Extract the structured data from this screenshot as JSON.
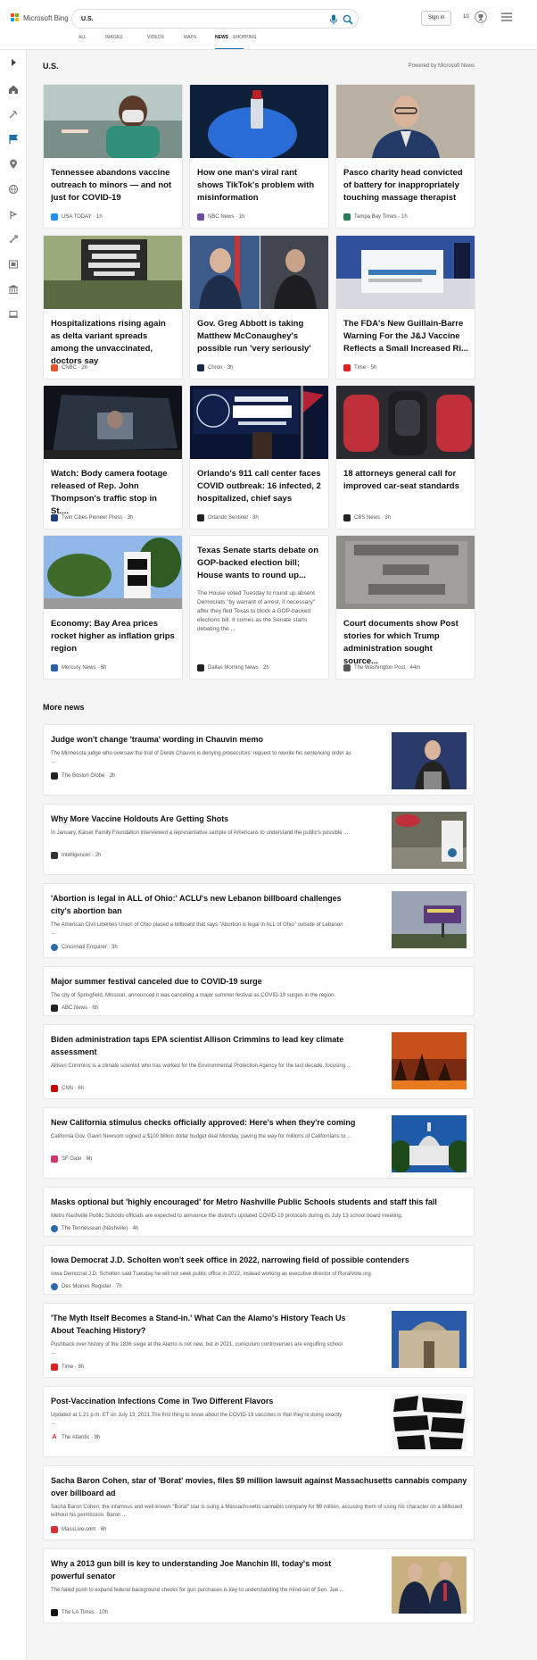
{
  "header": {
    "brand": "Microsoft Bing",
    "search_value": "U.S.",
    "signin_label": "Sign in",
    "rewards_count": "10",
    "tabs": [
      "ALL",
      "IMAGES",
      "VIDEOS",
      "MAPS",
      "NEWS",
      "SHOPPING"
    ],
    "active_tab": "NEWS"
  },
  "section": {
    "title": "U.S.",
    "powered_by": "Powered by Microsoft News"
  },
  "cards": [
    {
      "title": "Tennessee abandons vaccine outreach to minors — and not just for COVID-19",
      "source": "USA TODAY",
      "age": "1h",
      "favicon_color": "#1e90ff"
    },
    {
      "title": "How one man's viral rant shows TikTok's problem with misinformation",
      "source": "NBC News",
      "age": "1h",
      "favicon_color": "#6b4aa0"
    },
    {
      "title": "Pasco charity head convicted of battery for inappropriately touching massage therapist",
      "source": "Tampa Bay Times",
      "age": "1h",
      "favicon_color": "#2a7a5a"
    },
    {
      "title": "Hospitalizations rising again as delta variant spreads among the unvaccinated, doctors say",
      "source": "CNBC",
      "age": "2h",
      "favicon_color": "#e4572e"
    },
    {
      "title": "Gov. Greg Abbott is taking Matthew McConaughey's possible run 'very seriously'",
      "source": "Chron",
      "age": "3h",
      "favicon_color": "#1a2a44"
    },
    {
      "title": "The FDA's New Guillain-Barre Warning For the J&J Vaccine Reflects a Small Increased Ri...",
      "source": "Time",
      "age": "5h",
      "favicon_color": "#e32020"
    },
    {
      "title": "Watch: Body camera footage released of Rep. John Thompson's traffic stop in St....",
      "source": "Twin Cities Pioneer Press",
      "age": "3h",
      "favicon_color": "#1f3d7a"
    },
    {
      "title": "Orlando's 911 call center faces COVID outbreak: 16 infected, 2 hospitalized, chief says",
      "source": "Orlando Sentinel",
      "age": "3h",
      "favicon_color": "#222222"
    },
    {
      "title": "18 attorneys general call for improved car-seat standards",
      "source": "CBS News",
      "age": "3h",
      "favicon_color": "#222222"
    },
    {
      "title": "Economy: Bay Area prices rocket higher as inflation grips region",
      "source": "Mercury News",
      "age": "6h",
      "favicon_color": "#2b5ea8"
    },
    {
      "title": "Texas Senate starts debate on GOP-backed election bill; House wants to round up...",
      "source": "Dallas Morning News",
      "age": "2h",
      "favicon_color": "#222222",
      "description": "The House voted Tuesday to round up absent Democrats \"by warrant of arrest, if necessary\" after they fled Texas to block a GOP-backed elections bill. It comes as the Senate starts debating the ..."
    },
    {
      "title": "Court documents show Post stories for which Trump administration sought source...",
      "source": "The Washington Post",
      "age": "44m",
      "favicon_color": "#555555"
    }
  ],
  "more_news": {
    "title": "More news",
    "items": [
      {
        "title": "Judge won't change 'trauma' wording in Chauvin memo",
        "description": "The Minnesota judge who oversaw the trial of Derek Chauvin is denying prosecutors' request to rewrite his sentencing order as ...",
        "source": "The Boston Globe",
        "age": "2h",
        "favicon_color": "#222222"
      },
      {
        "title": "Why More Vaccine Holdouts Are Getting Shots",
        "description": "In January, Kaiser Family Foundation interviewed a representative sample of Americans to understand the public's possible ...",
        "source": "Intelligencer",
        "age": "2h",
        "favicon_color": "#333333"
      },
      {
        "title": "'Abortion is legal in ALL of Ohio:' ACLU's new Lebanon billboard challenges city's abortion ban",
        "description": "The American Civil Liberties Union of Ohio placed a billboard that says \"Abortion is legal in ALL of Ohio\" outside of Lebanon ...",
        "source": "Cincinnati Enquirer",
        "age": "3h",
        "favicon_color": "#2b6cb0"
      },
      {
        "title": "Major summer festival canceled due to COVID-19 surge",
        "description": "The city of Springfield, Missouri, announced it was canceling a major summer festival as COVID-19 surges in the region.",
        "source": "ABC News",
        "age": "6h",
        "favicon_color": "#222222"
      },
      {
        "title": "Biden administration taps EPA scientist Allison Crimmins to lead key climate assessment",
        "description": "Allison Crimmins is a climate scientist who has worked for the Environmental Protection Agency for the last decade, focusing ...",
        "source": "CNN",
        "age": "6h",
        "favicon_color": "#cc0000"
      },
      {
        "title": "New California stimulus checks officially approved: Here's when they're coming",
        "description": "California Gov. Gavin Newsom signed a $100 billion dollar budget deal Monday, paving the way for millions of Californians to ...",
        "source": "SF Gate",
        "age": "6h",
        "favicon_color": "#d6336c"
      },
      {
        "title": "Masks optional but 'highly encouraged' for Metro Nashville Public Schools students and staff this fall",
        "description": "Metro Nashville Public Schools officials are expected to announce the district's updated COVID-19 protocols during its July 13 school board meeting.",
        "source": "The Tennessean (Nashville)",
        "age": "4h",
        "favicon_color": "#2b6cb0"
      },
      {
        "title": "Iowa Democrat J.D. Scholten won't seek office in 2022, narrowing field of possible contenders",
        "description": "Iowa Democrat J.D. Scholten said Tuesday he will not seek public office in 2022, instead working as executive director of RuralVote.org.",
        "source": "Des Moines Register",
        "age": "7h",
        "favicon_color": "#2b6cb0"
      },
      {
        "title": "'The Myth Itself Becomes a Stand-in.' What Can the Alamo's History Teach Us About Teaching History?",
        "description": "Pushback over history of the 1836 siege at the Alamo is not new, but in 2021, curriculum controversies are engulfing school ...",
        "source": "Time",
        "age": "8h",
        "favicon_color": "#e32020"
      },
      {
        "title": "Post-Vaccination Infections Come in Two Different Flavors",
        "description": "Updated at 1:21 p.m. ET on July 13, 2021.The first thing to know about the COVID-19 vaccines is that they're doing exactly ...",
        "source": "The Atlantic",
        "age": "8h",
        "favicon_color": "#e32020"
      },
      {
        "title": "Sacha Baron Cohen, star of 'Borat' movies, files $9 million lawsuit against Massachusetts cannabis company over billboard ad",
        "description": "Sacha Baron Cohen, the infamous and well-known \"Borat\" star is suing a Massachusetts cannabis company for $9 million, accusing them of using his character on a billboard without his permission. Baron ...",
        "source": "MassLive.com",
        "age": "6h",
        "favicon_color": "#d63031"
      },
      {
        "title": "Why a 2013 gun bill is key to understanding Joe Manchin III, today's most powerful senator",
        "description": "The failed push to expand federal background checks for gun purchases is key to understanding the mind-set of Sen. Joe ...",
        "source": "The LA Times",
        "age": "10h",
        "favicon_color": "#111111"
      }
    ]
  },
  "colors": {
    "accent": "#1a73a8",
    "page_bg": "#f5f5f5",
    "card_bg": "#ffffff",
    "text": "#111111",
    "muted": "#555555"
  }
}
